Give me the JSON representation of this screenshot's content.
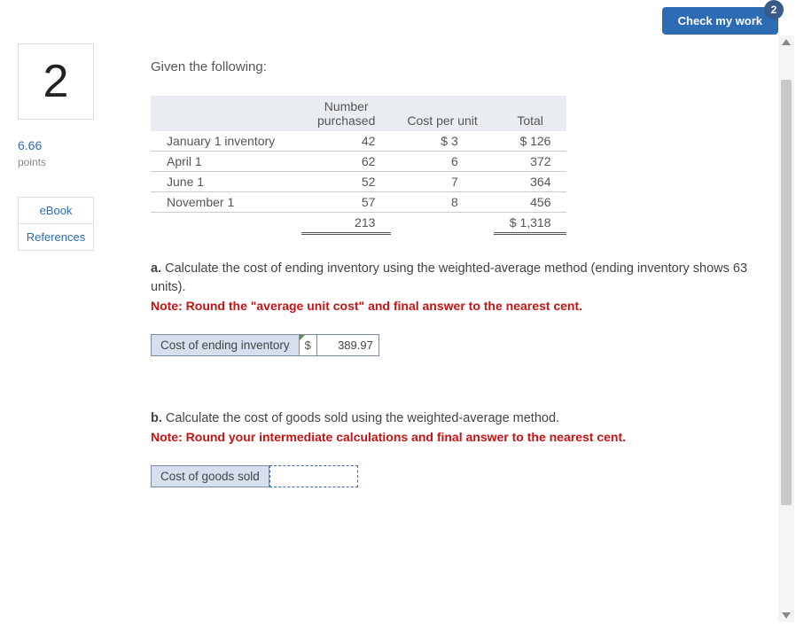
{
  "header": {
    "check_button": "Check my work",
    "badge_count": "2"
  },
  "sidebar": {
    "question_number": "2",
    "points_value": "6.66",
    "points_label": "points",
    "links": [
      {
        "label": "eBook"
      },
      {
        "label": "References"
      }
    ]
  },
  "main": {
    "prompt": "Given the following:",
    "table": {
      "headers": {
        "name": "",
        "number": "Number purchased",
        "cost": "Cost per unit",
        "total": "Total"
      },
      "rows": [
        {
          "name": "January 1 inventory",
          "number": "42",
          "cost": "$ 3",
          "total": "$ 126"
        },
        {
          "name": "April 1",
          "number": "62",
          "cost": "6",
          "total": "372"
        },
        {
          "name": "June 1",
          "number": "52",
          "cost": "7",
          "total": "364"
        },
        {
          "name": "November 1",
          "number": "57",
          "cost": "8",
          "total": "456"
        }
      ],
      "totals": {
        "number": "213",
        "total": "$ 1,318"
      }
    },
    "parts": {
      "a": {
        "letter": "a.",
        "text": " Calculate the cost of ending inventory using the weighted-average method (ending inventory shows 63 units).",
        "note": "Note: Round the \"average unit cost\" and final answer to the nearest cent.",
        "answer_label": "Cost of ending inventory",
        "currency": "$",
        "answer_value": "389.97"
      },
      "b": {
        "letter": "b.",
        "text": " Calculate the cost of goods sold using the weighted-average method.",
        "note": "Note: Round your intermediate calculations and final answer to the nearest cent.",
        "answer_label": "Cost of goods sold",
        "answer_value": ""
      }
    }
  }
}
